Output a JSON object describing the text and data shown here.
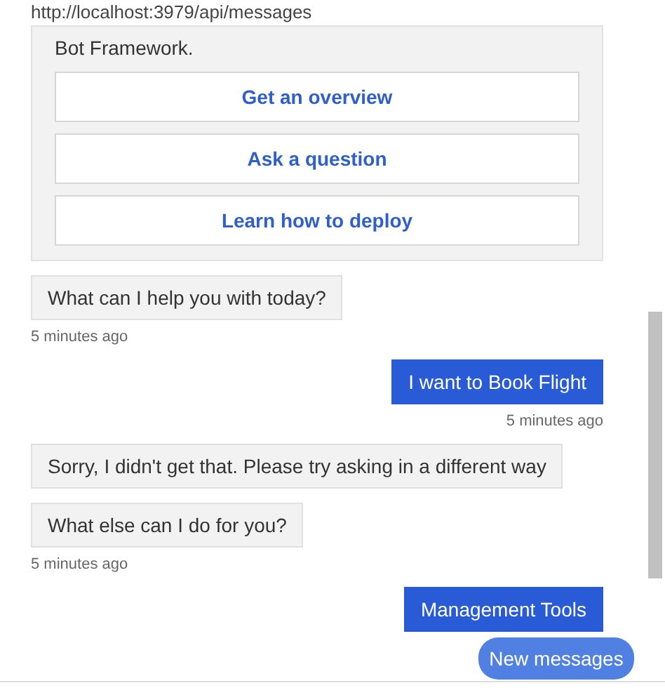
{
  "address": "http://localhost:3979/api/messages",
  "messages": [
    {
      "kind": "card",
      "text": "Bot Framework.",
      "buttons": [
        "Get an overview",
        "Ask a question",
        "Learn how to deploy"
      ]
    },
    {
      "kind": "incoming",
      "text": "What can I help you with today?",
      "timestamp": "5 minutes ago"
    },
    {
      "kind": "outgoing",
      "text": "I want to Book Flight",
      "timestamp": "5 minutes ago"
    },
    {
      "kind": "incoming",
      "text": "Sorry, I didn't get that. Please try asking in a different way"
    },
    {
      "kind": "incoming",
      "text": "What else can I do for you?",
      "timestamp": "5 minutes ago"
    },
    {
      "kind": "outgoing",
      "text": "Management Tools"
    }
  ],
  "new_messages_button": "New messages"
}
